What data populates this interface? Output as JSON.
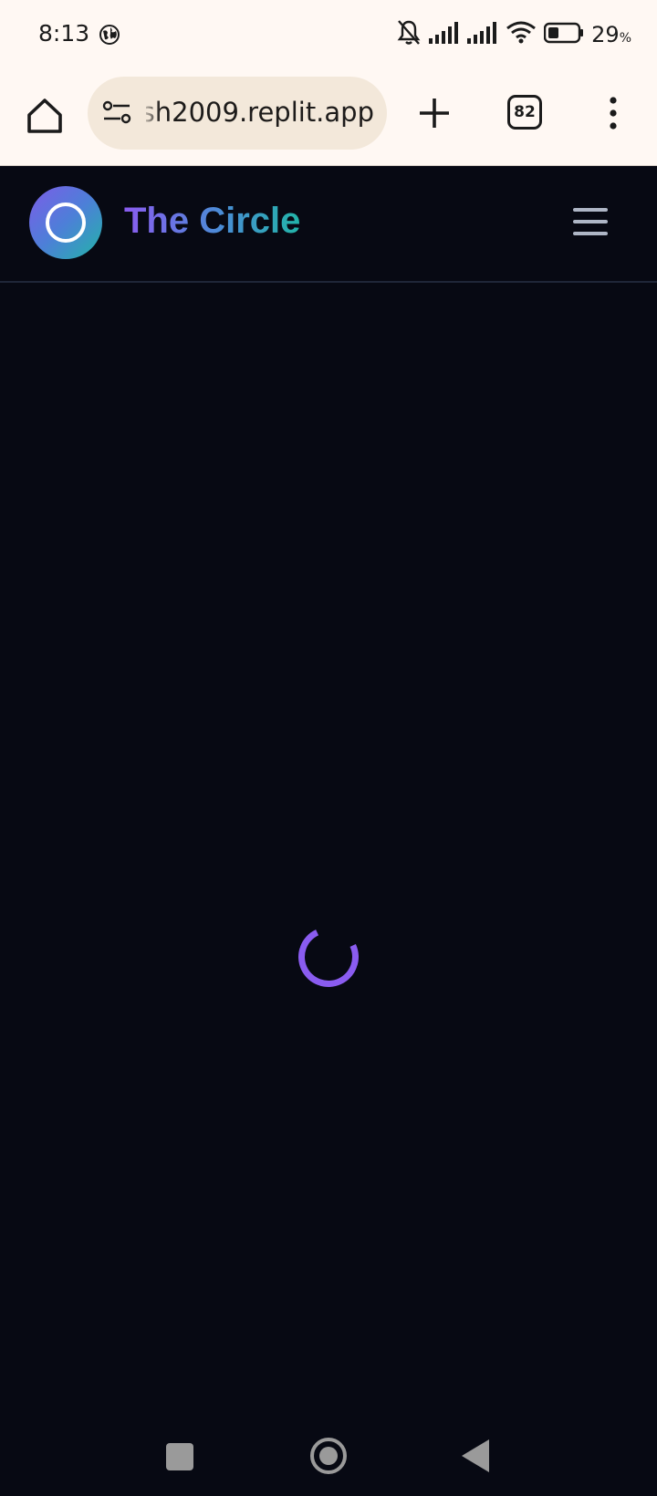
{
  "status": {
    "time": "8:13",
    "battery_value": "29",
    "battery_unit": "%",
    "icons": [
      "globe-icon",
      "bell-off-icon",
      "signal-icon",
      "signal-icon",
      "wifi-icon",
      "battery-icon"
    ]
  },
  "browser": {
    "url": "sh2009.replit.app",
    "tab_count": "82",
    "icons": [
      "home-icon",
      "tune-icon",
      "plus-icon",
      "tabs-icon",
      "more-vert-icon"
    ]
  },
  "app": {
    "title": "The Circle",
    "colors": {
      "background": "#070913",
      "accent_purple": "#8a5cf0",
      "accent_teal": "#22b4a8",
      "menu_icon": "#aeb6c6"
    }
  },
  "nav": {
    "icons": [
      "recents-icon",
      "home-circle-icon",
      "back-icon"
    ]
  }
}
